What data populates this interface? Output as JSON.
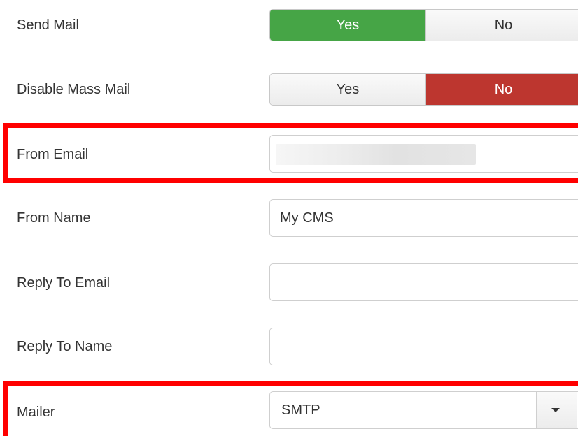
{
  "fields": {
    "send_mail": {
      "label": "Send Mail",
      "yes_label": "Yes",
      "no_label": "No",
      "selected": "Yes"
    },
    "disable_mass_mail": {
      "label": "Disable Mass Mail",
      "yes_label": "Yes",
      "no_label": "No",
      "selected": "No"
    },
    "from_email": {
      "label": "From Email",
      "value_redacted": true
    },
    "from_name": {
      "label": "From Name",
      "value": "My CMS"
    },
    "reply_to_email": {
      "label": "Reply To Email",
      "value": ""
    },
    "reply_to_name": {
      "label": "Reply To Name",
      "value": ""
    },
    "mailer": {
      "label": "Mailer",
      "value": "SMTP"
    }
  },
  "colors": {
    "toggle_yes_active": "#46a546",
    "toggle_no_active": "#bd362f",
    "highlight_box": "#ff0000"
  },
  "icons": {
    "mailer_dropdown": "caret-down-icon"
  }
}
